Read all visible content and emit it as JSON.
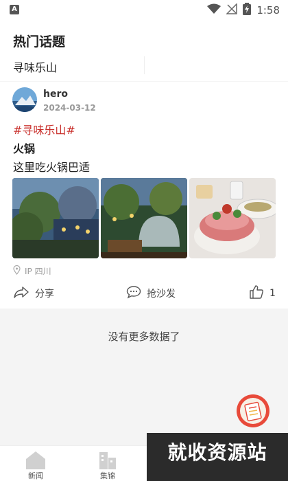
{
  "status_bar": {
    "left_icon": "A",
    "time": "1:58",
    "icons": [
      "wifi-icon",
      "signal-off-icon",
      "battery-charging-icon"
    ]
  },
  "header": {
    "title": "热门话题",
    "topic": "寻味乐山"
  },
  "post": {
    "author": "hero",
    "date": "2024-03-12",
    "hashtag": "#寻味乐山#",
    "title": "火锅",
    "body": "这里吃火锅巴适",
    "location": "IP 四川",
    "images": [
      "garden-night-photo",
      "terrace-dome-photo",
      "hotpot-cake-photo"
    ],
    "actions": {
      "share": "分享",
      "comment": "抢沙发",
      "like_count": "1"
    }
  },
  "feed_end": {
    "message": "没有更多数据了"
  },
  "bottom_nav": [
    {
      "label": "新闻",
      "icon": "home-icon"
    },
    {
      "label": "集锦",
      "icon": "buildings-icon"
    }
  ],
  "watermark": "就收资源站",
  "colors": {
    "accent": "#c9302c",
    "muted": "#999999",
    "background": "#f5f5f5"
  }
}
